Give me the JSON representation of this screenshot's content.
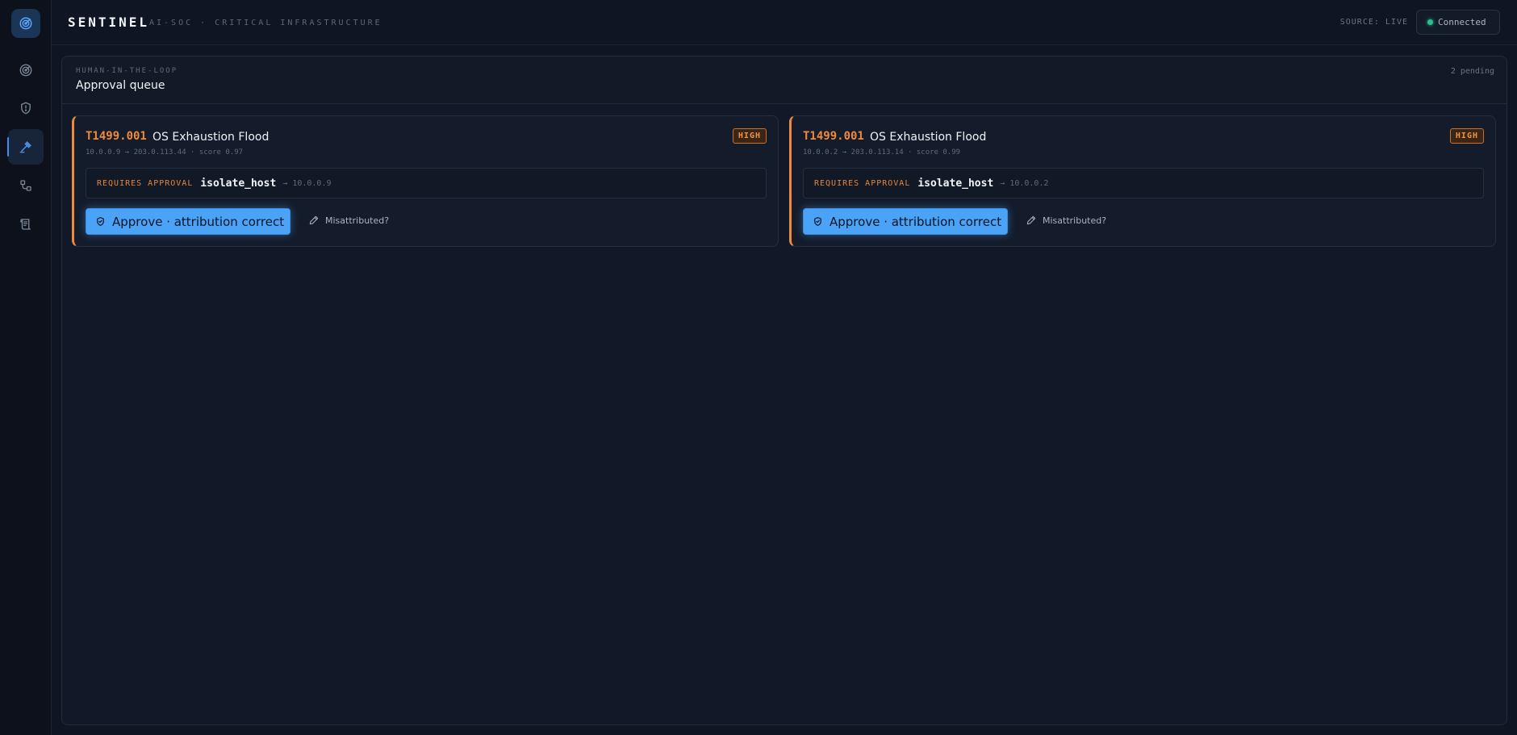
{
  "app": {
    "name": "SENTINEL",
    "subtitle": "AI-SOC · CRITICAL INFRASTRUCTURE",
    "source_label": "SOURCE: LIVE",
    "connection_status": "Connected",
    "accent_color": "#3f8cf5",
    "status_color": "#22c38e"
  },
  "sidebar": {
    "items": [
      {
        "icon": "radar-icon",
        "active": false
      },
      {
        "icon": "shield-icon",
        "active": false
      },
      {
        "icon": "gavel-icon",
        "active": true
      },
      {
        "icon": "workflow-icon",
        "active": false
      },
      {
        "icon": "scroll-icon",
        "active": false
      }
    ]
  },
  "panel": {
    "kicker": "HUMAN-IN-THE-LOOP",
    "title": "Approval queue",
    "count": "2 pending"
  },
  "cards": [
    {
      "technique": "T1499.001",
      "title": "OS Exhaustion Flood",
      "severity": "HIGH",
      "meta": "10.0.0.9 → 203.0.113.44 · score 0.97",
      "requires_label": "REQUIRES APPROVAL",
      "action": "isolate_host",
      "target": "→ 10.0.0.9",
      "approve_label": "Approve · attribution correct",
      "misattributed_label": "Misattributed?"
    },
    {
      "technique": "T1499.001",
      "title": "OS Exhaustion Flood",
      "severity": "HIGH",
      "meta": "10.0.0.2 → 203.0.113.14 · score 0.99",
      "requires_label": "REQUIRES APPROVAL",
      "action": "isolate_host",
      "target": "→ 10.0.0.2",
      "approve_label": "Approve · attribution correct",
      "misattributed_label": "Misattributed?"
    }
  ]
}
